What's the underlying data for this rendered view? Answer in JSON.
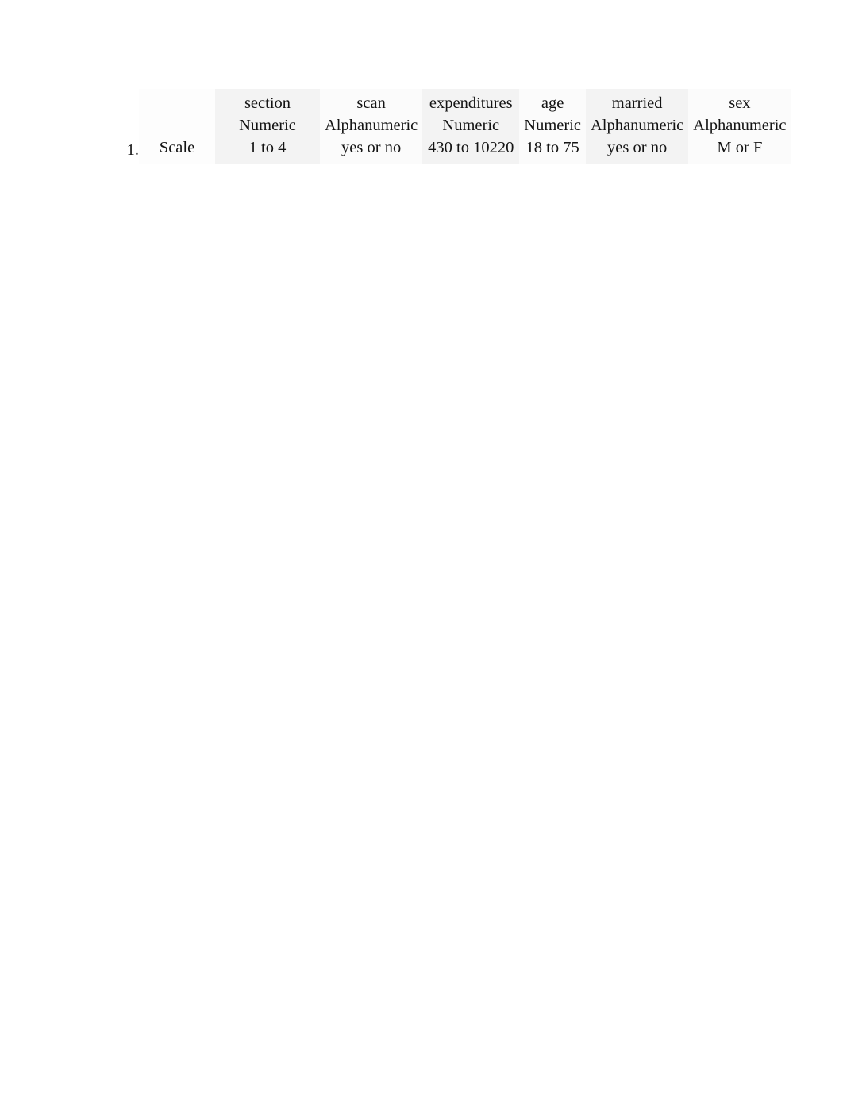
{
  "document": {
    "list_marker": "1.",
    "row_label": "Scale"
  },
  "table": {
    "columns": [
      {
        "name": "section",
        "type": "Numeric",
        "scale": "1 to 4"
      },
      {
        "name": "scan",
        "type": "Alphanumeric",
        "scale": "yes or no"
      },
      {
        "name": "expenditures",
        "type": "Numeric",
        "scale": "430 to 10220"
      },
      {
        "name": "age",
        "type": "Numeric",
        "scale": "18 to 75"
      },
      {
        "name": "married",
        "type": "Alphanumeric",
        "scale": "yes or no"
      },
      {
        "name": "sex",
        "type": "Alphanumeric",
        "scale": "M or F"
      }
    ],
    "row_headers": [
      "",
      "",
      "Scale"
    ],
    "header_row": {
      "corner": "",
      "section": "section",
      "scan": "scan",
      "expenditures": "expenditures",
      "age": "age",
      "married": "married",
      "sex": "sex"
    },
    "type_row": {
      "corner": "",
      "section": "Numeric",
      "scan": "Alphanumeric",
      "expenditures": "Numeric",
      "age": "Numeric",
      "married": "Alphanumeric",
      "sex": "Alphanumeric"
    },
    "scale_row": {
      "corner": "Scale",
      "section": "1 to 4",
      "scan": "yes or no",
      "expenditures": "430 to 10220",
      "age": "18 to 75",
      "married": "yes or no",
      "sex": "M or F"
    }
  },
  "style": {
    "page_background": "#ffffff",
    "text_color": "#141414",
    "cell_shade": "#f3f3f3",
    "cell_plain": "#fbfbfb"
  }
}
